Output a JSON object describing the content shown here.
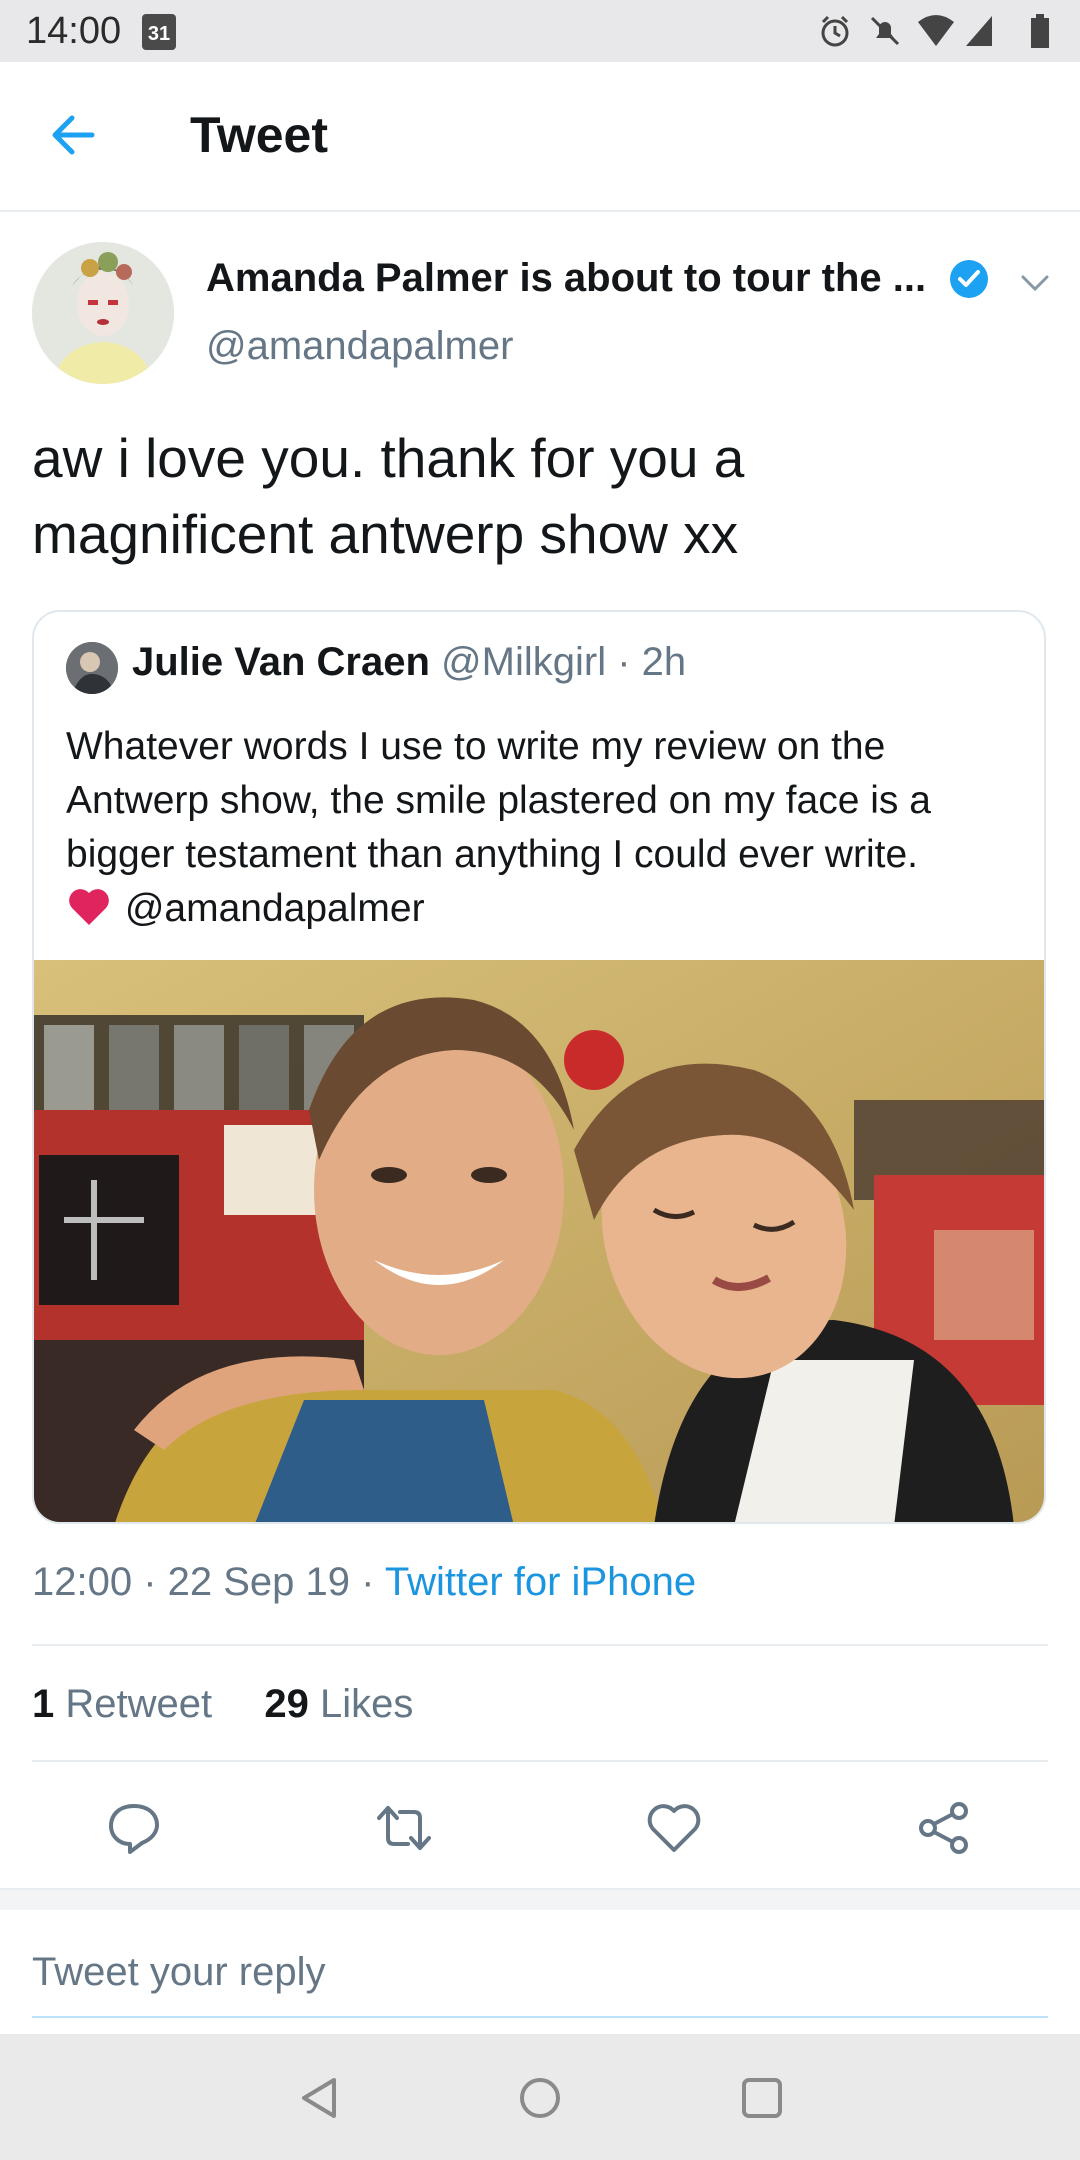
{
  "status_bar": {
    "time": "14:00",
    "calendar_day": "31"
  },
  "header": {
    "title": "Tweet"
  },
  "tweet": {
    "author_name": "Amanda Palmer is about to tour the ...",
    "author_handle": "@amandapalmer",
    "text": "aw i love you. thank for you a magnificent antwerp show xx",
    "time": "12:00 · 22 Sep 19 · ",
    "source": "Twitter for iPhone",
    "retweet_count": "1",
    "retweet_label": " Retweet",
    "like_count": "29",
    "like_label": " Likes"
  },
  "quoted": {
    "name": "Julie Van Craen",
    "meta": " @Milkgirl · 2h",
    "text": "Whatever words I use to write my review on the Antwerp show, the smile plastered on my face is a bigger testament than anything I could ever write.",
    "mention": "@amandapalmer"
  },
  "reply": {
    "placeholder": "Tweet your reply"
  },
  "colors": {
    "accent": "#1da1f2",
    "muted": "#657786",
    "heart": "#e0245e"
  }
}
